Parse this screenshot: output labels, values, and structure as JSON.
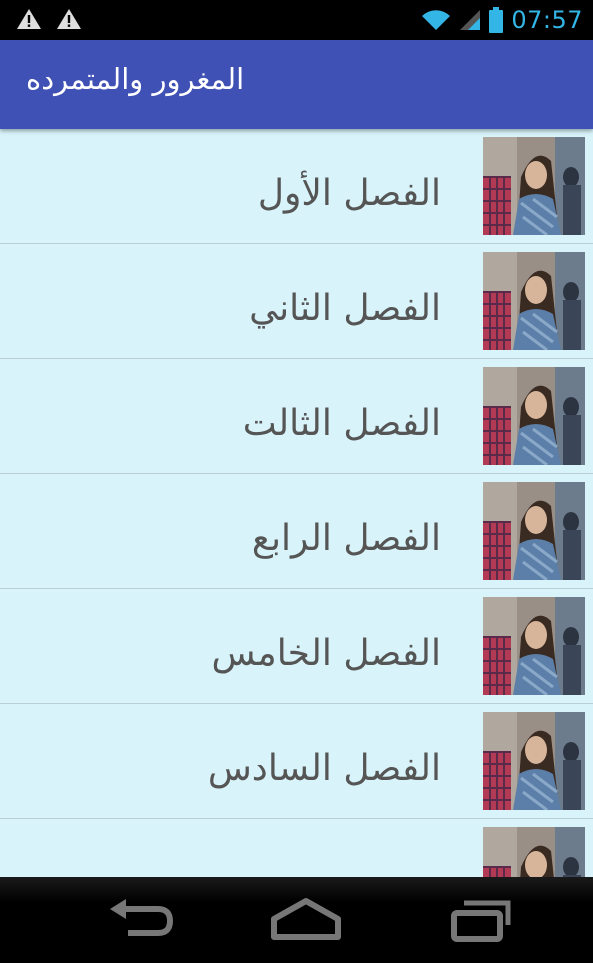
{
  "status_bar": {
    "time": "07:57",
    "icons": [
      "warning-icon",
      "warning-icon",
      "wifi-icon",
      "signal-icon",
      "battery-icon"
    ]
  },
  "app_bar": {
    "title": "المغرور والمتمرده"
  },
  "chapters": [
    {
      "label": "الفصل الأول",
      "thumbnail": "chapter-thumbnail"
    },
    {
      "label": "الفصل الثاني",
      "thumbnail": "chapter-thumbnail"
    },
    {
      "label": "الفصل الثالت",
      "thumbnail": "chapter-thumbnail"
    },
    {
      "label": "الفصل الرابع",
      "thumbnail": "chapter-thumbnail"
    },
    {
      "label": "الفصل الخامس",
      "thumbnail": "chapter-thumbnail"
    },
    {
      "label": "الفصل السادس",
      "thumbnail": "chapter-thumbnail"
    },
    {
      "label": "",
      "thumbnail": "chapter-thumbnail"
    }
  ],
  "nav_bar": {
    "buttons": [
      "back-icon",
      "home-icon",
      "recent-apps-icon"
    ]
  },
  "colors": {
    "status_accent": "#33b5e5",
    "app_bar": "#3f51b5",
    "list_background": "#d8f4fa",
    "label_text": "#555555"
  }
}
